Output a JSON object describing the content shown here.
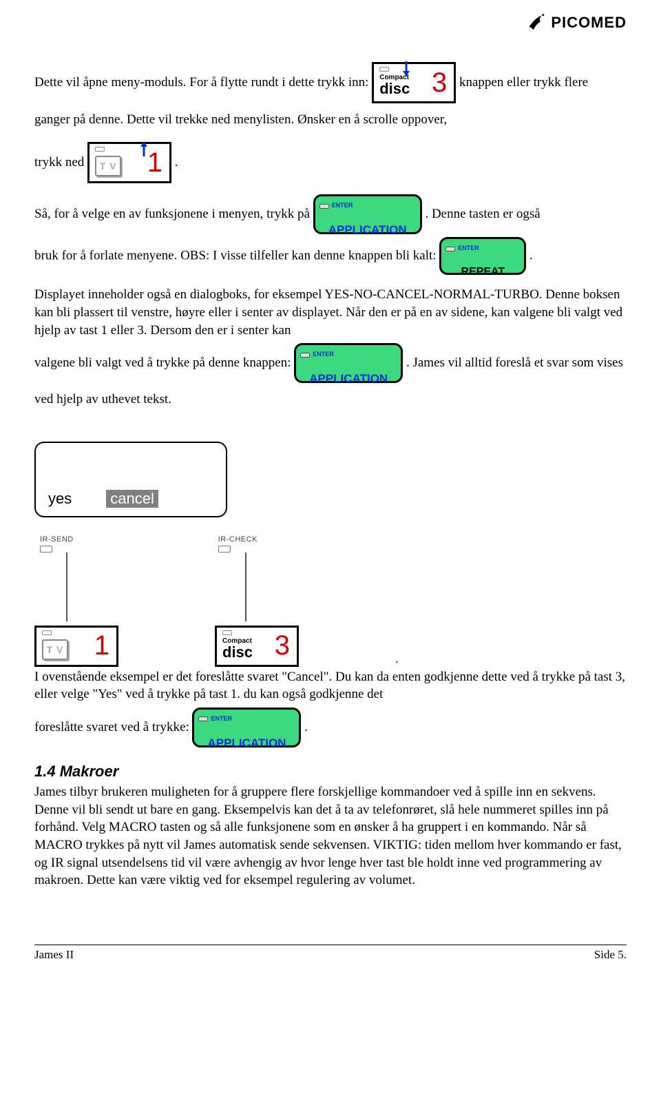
{
  "brand": "PICOMED",
  "para1_part1": "Dette vil åpne meny-moduls. For å flytte rundt i dette trykk inn: ",
  "para1_part2": "knappen eller trykk flere ganger på denne. Dette vil trekke ned menylisten. Ønsker en å scrolle oppover,",
  "para1_part3": "trykk ned ",
  "para1_part4": ".",
  "para2_part1": "Så, for å velge en av funksjonene i menyen, trykk på ",
  "para2_part2": ". Denne tasten er også",
  "para2_part3": "bruk for å forlate menyene. OBS: I visse tilfeller kan denne knappen bli kalt: ",
  "para2_part4": ".",
  "para3": "Displayet inneholder også en dialogboks, for eksempel YES-NO-CANCEL-NORMAL-TURBO. Denne boksen kan bli plassert til venstre, høyre eller i senter av displayet. Når den er på en av sidene, kan valgene bli valgt ved hjelp av tast 1 eller 3. Dersom den er i senter kan",
  "para3b_part1": "valgene bli valgt ved å trykke på denne knappen: ",
  "para3b_part2": ". James vil alltid foreslå et svar som vises ved hjelp av uthevet tekst.",
  "dialog": {
    "yes": "yes",
    "cancel": "cancel"
  },
  "ir": {
    "send": "IR-SEND",
    "check": "IR-CHECK"
  },
  "para4_part1": "I ovenstående eksempel er det foreslåtte svaret \"Cancel\". Du kan da enten godkjenne dette ved å trykke på tast 3, eller velge \"Yes\" ved å trykke på tast 1. du kan også godkjenne det",
  "para4_part2": "foreslåtte svaret ved å trykke: ",
  "para4_part3": ".",
  "section_heading": "1.4   Makroer",
  "para5": "James tilbyr brukeren muligheten for å gruppere flere forskjellige kommandoer ved å spille inn en sekvens. Denne vil bli sendt ut bare en gang. Eksempelvis kan det å ta av telefonrøret, slå hele nummeret spilles inn på forhånd. Velg MACRO tasten og så alle funksjonene som en ønsker å ha gruppert i en kommando. Når så MACRO trykkes på nytt vil James automatisk sende sekvensen. VIKTIG: tiden mellom hver kommando er fast, og IR signal utsendelsens tid vil være avhengig av hvor lenge hver tast ble holdt inne ved programmering av makroen. Dette kan være viktig ved for eksempel regulering av volumet.",
  "key_labels": {
    "compact": "Compact",
    "disc": "disc",
    "three": "3",
    "one": "1",
    "tv": "T V",
    "enter": "ENTER",
    "application": "APPLICATION",
    "repeat": "REPEAT"
  },
  "footer": {
    "left": "James II",
    "right": "Side 5."
  }
}
